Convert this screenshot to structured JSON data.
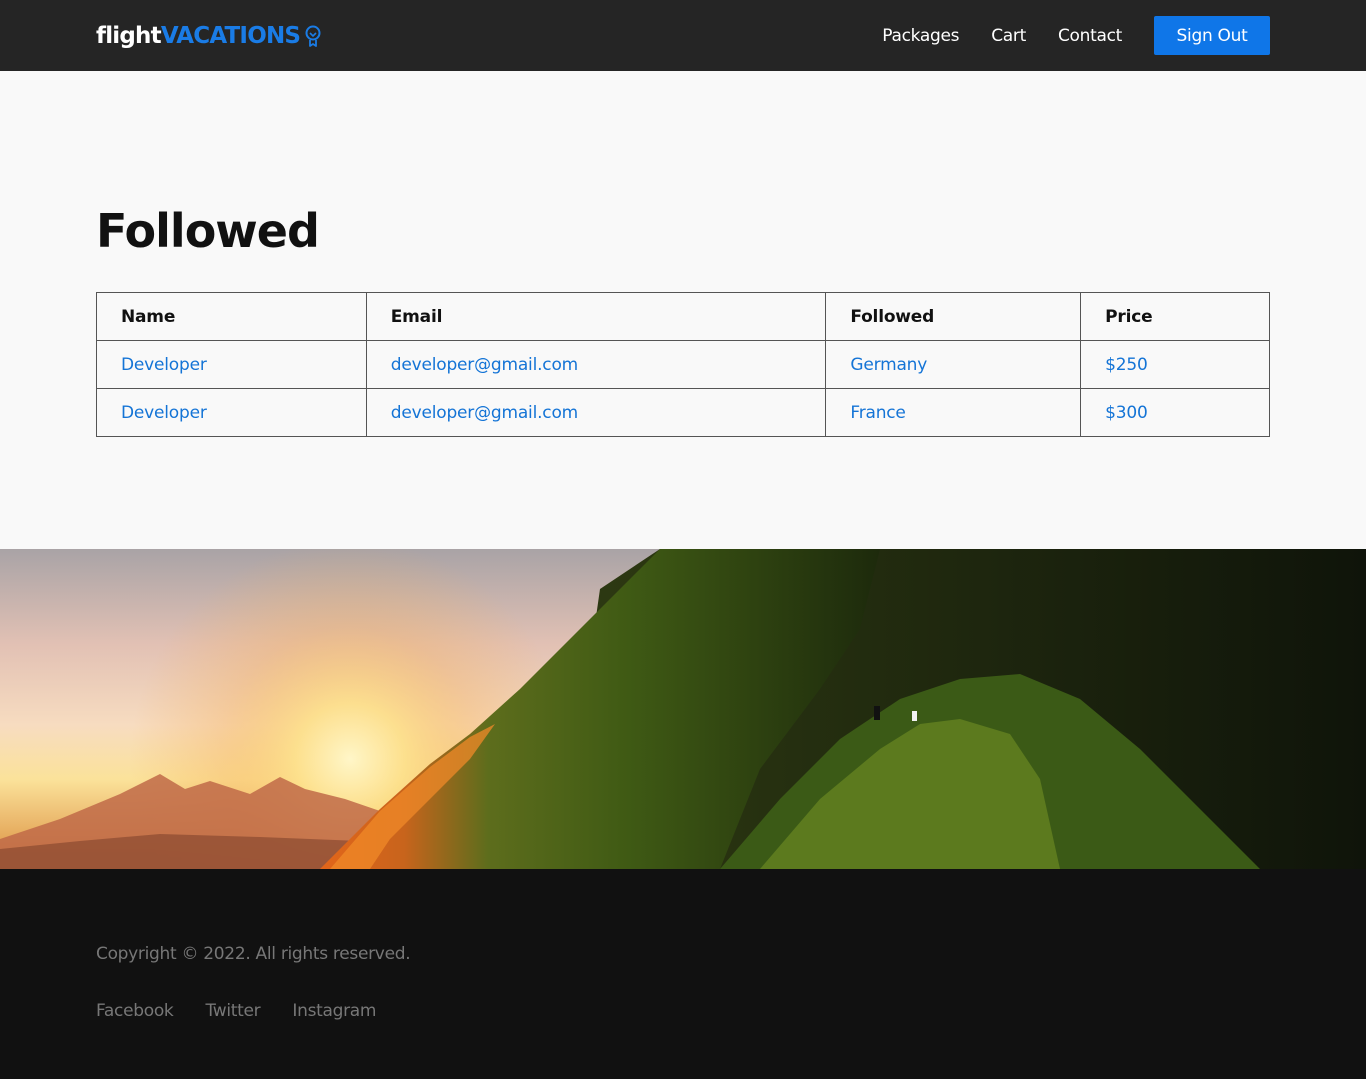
{
  "brand": {
    "part1": "flight",
    "part2": "VACATIONS",
    "icon": "lightbulb-icon"
  },
  "nav": {
    "links": [
      "Packages",
      "Cart",
      "Contact"
    ],
    "signout_label": "Sign Out"
  },
  "colors": {
    "accent": "#0f76e8",
    "link": "#1474d6",
    "navbar": "#252525",
    "footer": "#111111"
  },
  "main": {
    "title": "Followed",
    "table": {
      "headers": [
        "Name",
        "Email",
        "Followed",
        "Price"
      ],
      "rows": [
        [
          "Developer",
          "developer@gmail.com",
          "Germany",
          "$250"
        ],
        [
          "Developer",
          "developer@gmail.com",
          "France",
          "$300"
        ]
      ]
    }
  },
  "footer": {
    "copyright": "Copyright © 2022. All rights reserved.",
    "social": [
      "Facebook",
      "Twitter",
      "Instagram"
    ]
  }
}
